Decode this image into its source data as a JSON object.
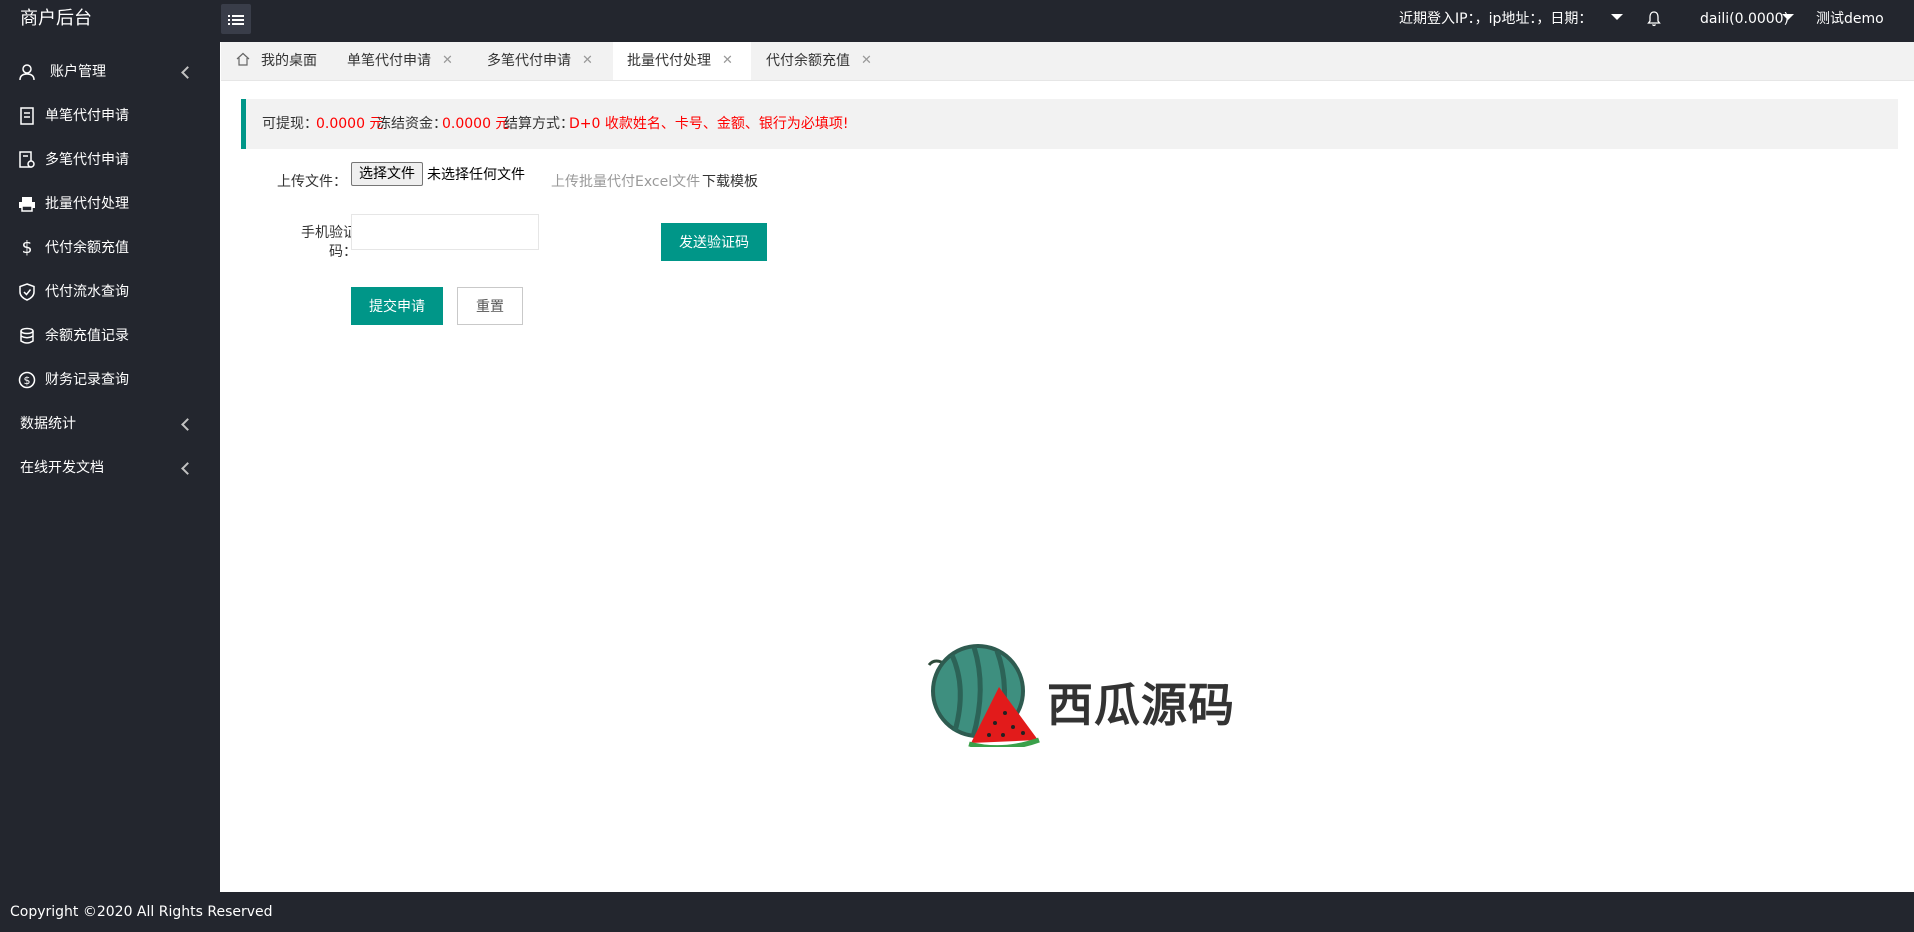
{
  "header": {
    "logo": "商户后台",
    "login_info": "近期登入IP：，ip地址：，日期：",
    "user": "daili(0.0000)",
    "account": "测试demo"
  },
  "sidebar": {
    "items": [
      {
        "label": "账户管理",
        "icon": "user-icon"
      },
      {
        "label": "单笔代付申请",
        "icon": "document-icon"
      },
      {
        "label": "多笔代付申请",
        "icon": "document-edit-icon"
      },
      {
        "label": "批量代付处理",
        "icon": "printer-icon"
      },
      {
        "label": "代付余额充值",
        "icon": "dollar-icon"
      },
      {
        "label": "代付流水查询",
        "icon": "shield-check-icon"
      },
      {
        "label": "余额充值记录",
        "icon": "database-icon"
      },
      {
        "label": "财务记录查询",
        "icon": "dollar-circle-icon"
      },
      {
        "label": "数据统计",
        "icon": ""
      },
      {
        "label": "在线开发文档",
        "icon": ""
      }
    ]
  },
  "tabs": [
    {
      "label": "我的桌面",
      "icon": "home-icon"
    },
    {
      "label": "单笔代付申请"
    },
    {
      "label": "多笔代付申请"
    },
    {
      "label": "批量代付处理",
      "active": true
    },
    {
      "label": "代付余额充值"
    }
  ],
  "info": {
    "withdrawable_label": "可提现：",
    "withdrawable_value": "0.0000 元",
    "frozen_label": "冻结资金：",
    "frozen_value": "0.0000 元",
    "settlement_label": "结算方式：",
    "settlement_value": "D+0 收款姓名、卡号、金额、银行为必填项!"
  },
  "form": {
    "upload_label": "上传文件：",
    "file_button": "选择文件",
    "file_status": "未选择任何文件",
    "upload_hint": "上传批量代付Excel文件",
    "download_link": "下载模板",
    "sms_label_line1": "手机验证",
    "sms_label_line2": "码：",
    "sms_value": "",
    "send_code_button": "发送验证码",
    "submit_button": "提交申请",
    "reset_button": "重置"
  },
  "watermark": {
    "text": "西瓜源码"
  },
  "footer": {
    "copyright": "Copyright ©2020 All Rights Reserved"
  },
  "colors": {
    "accent": "#009688",
    "dark": "#23262e",
    "alert": "#ff0000"
  }
}
